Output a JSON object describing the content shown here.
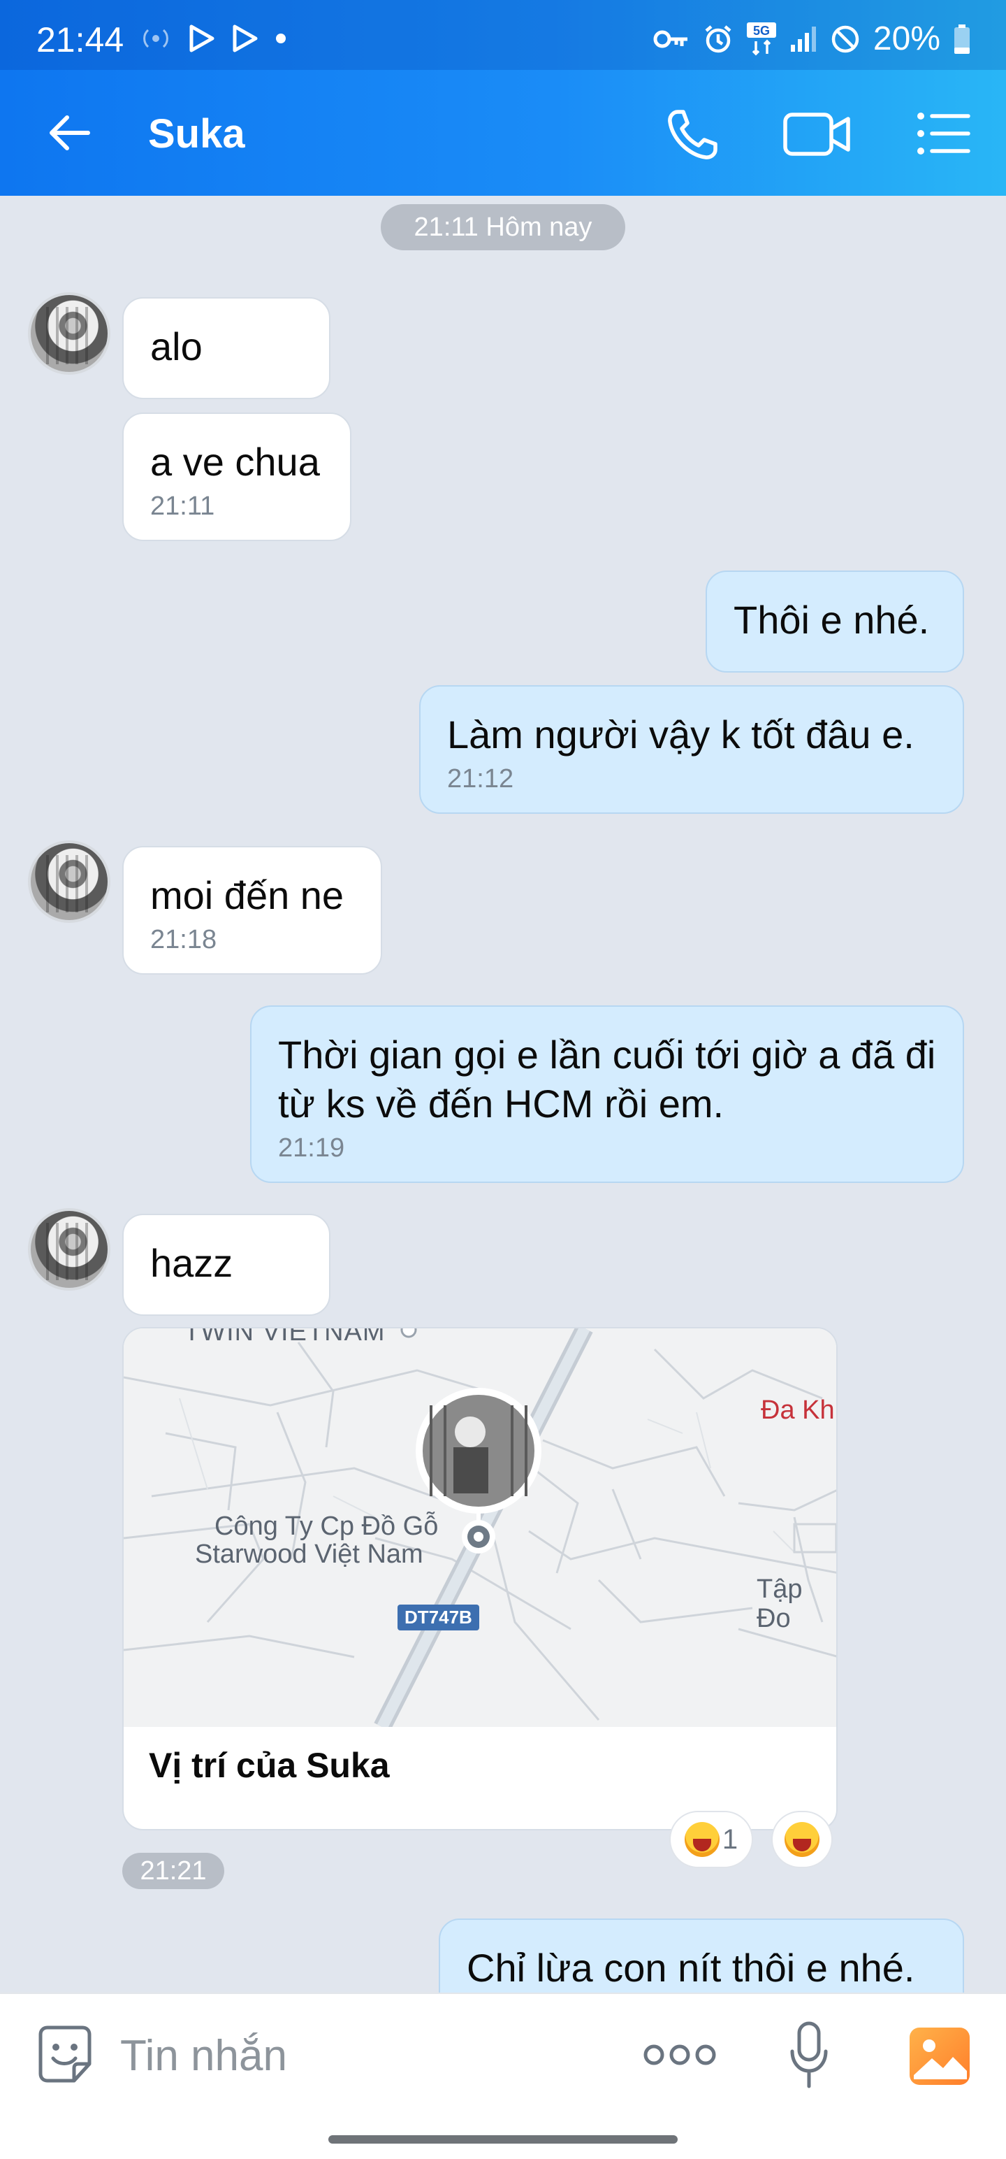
{
  "status_bar": {
    "time": "21:44",
    "battery": "20%",
    "network_badge": "5G",
    "left_icons": [
      "radio-icon",
      "play-store-icon",
      "play-store-icon",
      "dot-icon"
    ],
    "right_icons": [
      "key-icon",
      "alarm-icon",
      "5g-signal-icon",
      "signal-icon",
      "do-not-disturb-icon",
      "battery-icon"
    ]
  },
  "header": {
    "title": "Suka",
    "icons": [
      "back-arrow-icon",
      "phone-icon",
      "video-camera-icon",
      "menu-list-icon"
    ]
  },
  "chat": {
    "date_label": "21:11 Hôm nay",
    "messages": [
      {
        "side": "in",
        "text": "alo",
        "time": ""
      },
      {
        "side": "in",
        "text": "a ve chua",
        "time": "21:11"
      },
      {
        "side": "out",
        "text": "Thôi e nhé.",
        "time": ""
      },
      {
        "side": "out",
        "text": "Làm người vậy k tốt đâu e.",
        "time": "21:12"
      },
      {
        "side": "in",
        "text": "moi đến ne",
        "time": "21:18"
      },
      {
        "side": "out",
        "text": "Thời gian gọi e lần cuối tới giờ a đã đi từ ks về đến HCM rồi em.",
        "time": "21:19"
      },
      {
        "side": "in",
        "text": "hazz",
        "time": ""
      },
      {
        "side": "out",
        "text": "Chỉ lừa con nít thôi e nhé.",
        "time": ""
      }
    ],
    "location_card": {
      "caption": "Vị trí của Suka",
      "map_labels": [
        "TWIN VIETNAM",
        "Đa Kh",
        "Công Ty Cp Đồ Gỗ",
        "Starwood Việt Nam",
        "Tập Đo"
      ],
      "road_label": "DT747B",
      "time": "21:21",
      "reactions": [
        {
          "emoji": "laughing-face-icon",
          "count": "1"
        },
        {
          "emoji": "laughing-face-icon",
          "count": ""
        }
      ]
    }
  },
  "input_bar": {
    "placeholder": "Tin nhắn",
    "icons": [
      "sticker-icon",
      "more-icon",
      "microphone-icon",
      "image-icon"
    ]
  },
  "colors": {
    "header_gradient_start": "#0e76f0",
    "header_gradient_end": "#29b6f6",
    "chat_background": "#e1e6ee",
    "incoming_bubble": "#ffffff",
    "outgoing_bubble": "#d4ecfe",
    "image_button": "#ff9f3a"
  }
}
